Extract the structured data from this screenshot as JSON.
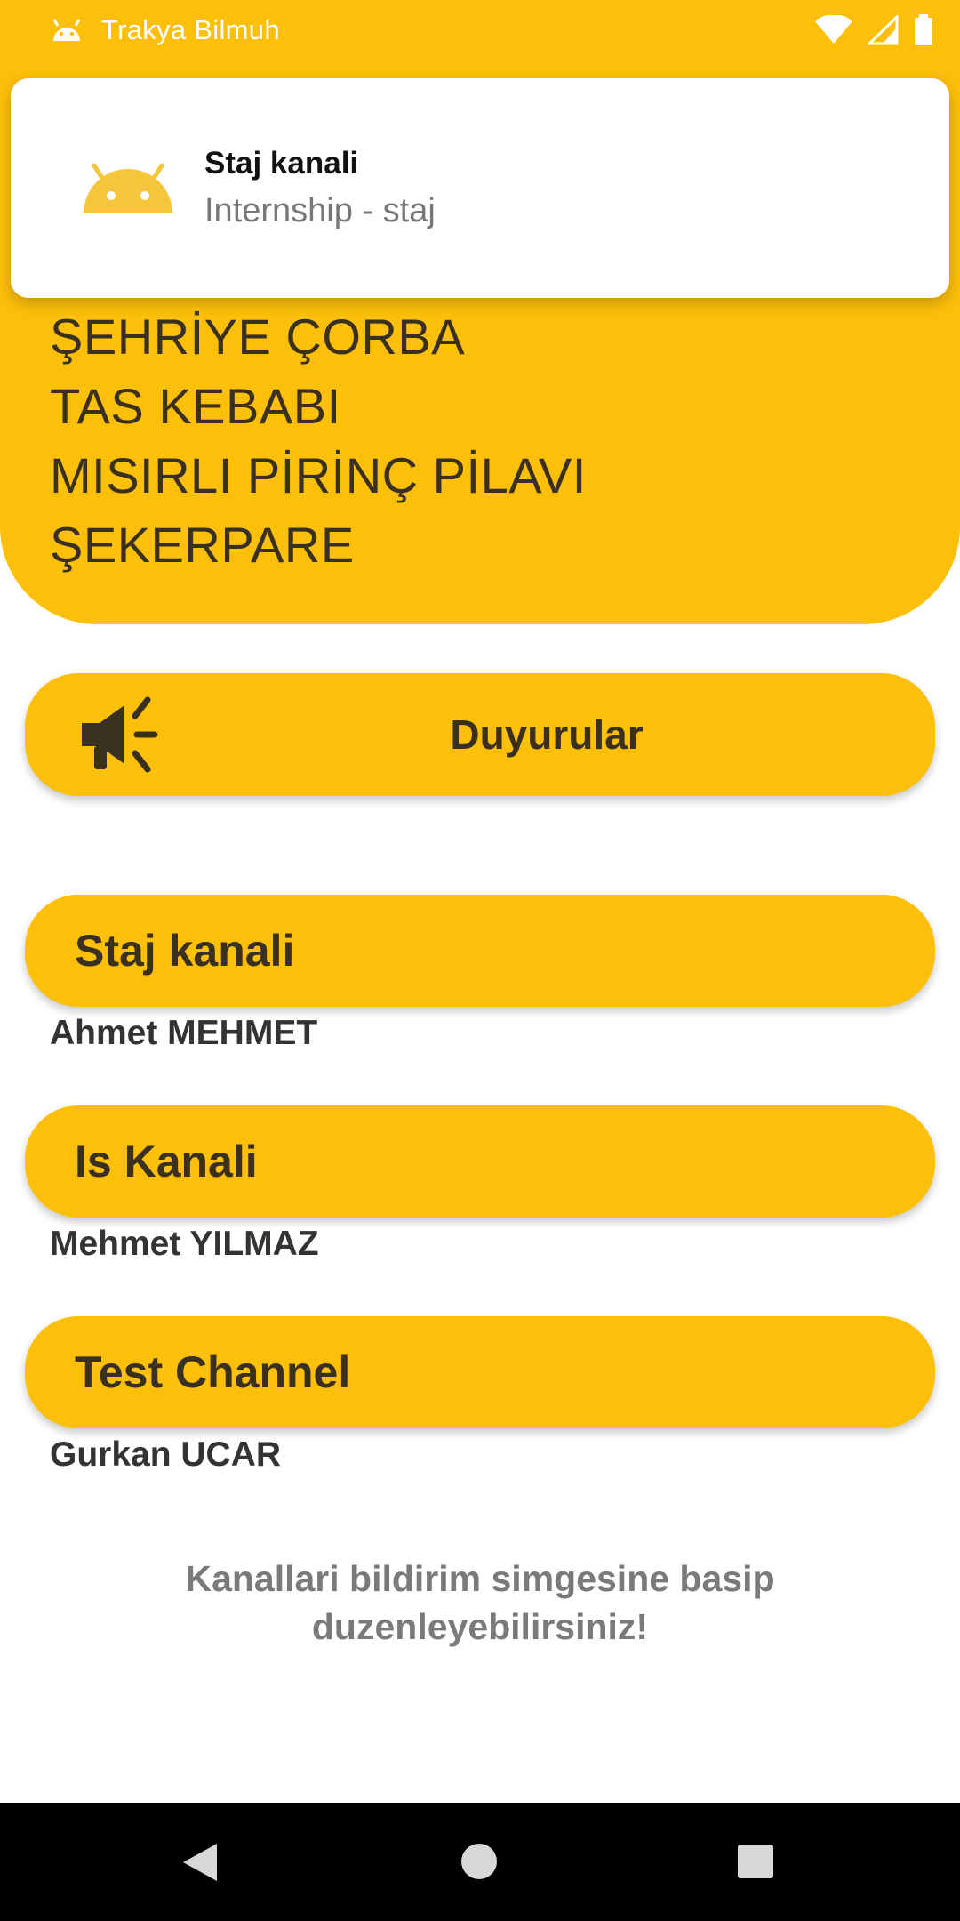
{
  "status_bar": {
    "app_name": "Trakya Bilmuh",
    "icons": [
      "android-icon",
      "wifi-icon",
      "signal-icon",
      "battery-icon"
    ]
  },
  "notification": {
    "title": "Staj kanali",
    "body": "Internship - staj",
    "icon": "android-icon"
  },
  "menu": {
    "items": [
      "ŞEHRİYE ÇORBA",
      "TAS KEBABI",
      "MISIRLI PİRİNÇ PİLAVI",
      "ŞEKERPARE"
    ]
  },
  "announcements_button": {
    "label": "Duyurular",
    "icon": "megaphone-icon"
  },
  "channels": [
    {
      "name": "Staj kanali",
      "owner": "Ahmet MEHMET"
    },
    {
      "name": "Is Kanali",
      "owner": "Mehmet YILMAZ"
    },
    {
      "name": "Test Channel",
      "owner": "Gurkan UCAR"
    }
  ],
  "hint": {
    "line1": "Kanallari bildirim simgesine basip",
    "line2": "duzenleyebilirsiniz!"
  },
  "nav_bar": {
    "buttons": [
      "back-icon",
      "home-icon",
      "recents-icon"
    ]
  },
  "colors": {
    "accent": "#FCBF0A",
    "text_dark": "#3a3020",
    "hint_gray": "#7a7a7a"
  }
}
